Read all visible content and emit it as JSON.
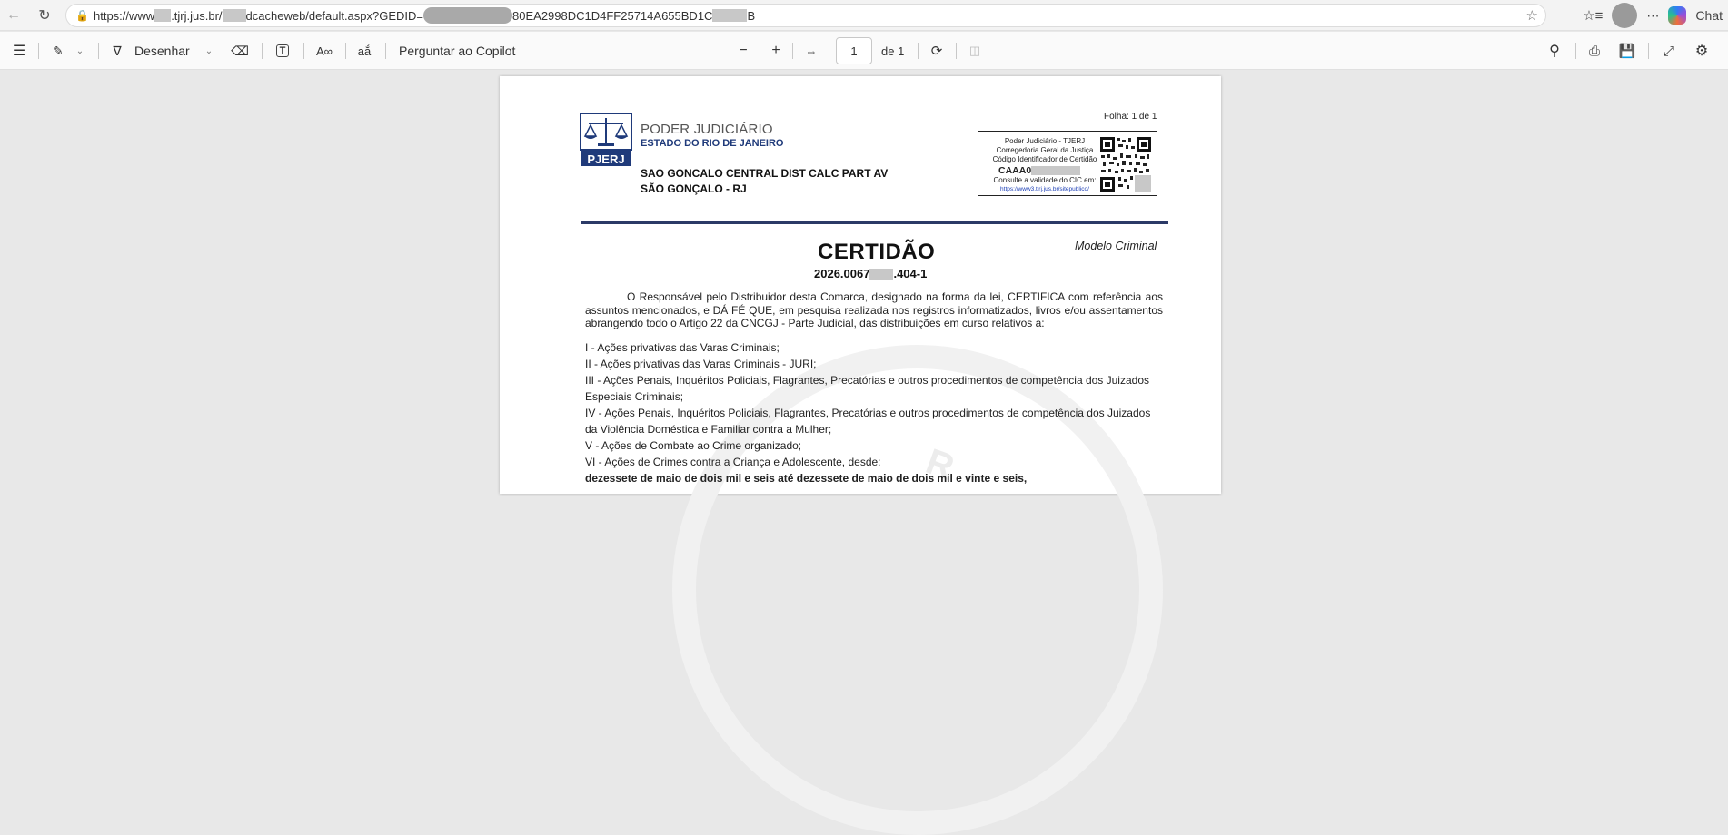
{
  "browser": {
    "url_prefix": "https://www",
    "url_mid1": ".tjrj.jus.br/",
    "url_mid2": "dcacheweb/default.aspx?GEDID=",
    "url_suffix": "80EA2998DC1D4FF25714A655BD1C",
    "url_end": "B",
    "chat_label": "Chat"
  },
  "toolbar": {
    "draw_label": "Desenhar",
    "copilot_label": "Perguntar ao Copilot",
    "page_current": "1",
    "page_total": "de 1"
  },
  "document": {
    "org_title": "PODER JUDICIÁRIO",
    "org_subtitle": "ESTADO DO RIO DE JANEIRO",
    "seal_text": "PJERJ",
    "district_line1": "SAO GONCALO CENTRAL DIST CALC PART AV",
    "district_line2": "SÃO GONÇALO - RJ",
    "folha": "Folha: 1 de 1",
    "cert_box": {
      "line1": "Poder Judiciário - TJERJ",
      "line2": "Corregedoria Geral da Justiça",
      "line3": "Código Identificador de Certidão",
      "code": "CAAA0",
      "line4": "Consulte a validade do CIC em:",
      "link": "https://www3.tjrj.jus.br/sitepublico/"
    },
    "title": "CERTIDÃO",
    "modelo": "Modelo Criminal",
    "number_prefix": "2026.0067",
    "number_suffix": ".404-1",
    "intro": "O Responsável pelo Distribuidor desta Comarca, designado na forma da lei, CERTIFICA com referência aos assuntos mencionados, e DÁ FÉ QUE, em pesquisa realizada nos registros informatizados, livros e/ou assentamentos abrangendo todo o Artigo 22 da CNCGJ - Parte Judicial, das distribuições em curso relativos a:",
    "items": [
      "I - Ações privativas das Varas Criminais;",
      "II - Ações privativas das Varas Criminais - JURI;",
      "III - Ações Penais, Inquéritos Policiais, Flagrantes, Precatórias e outros procedimentos de competência dos Juizados",
      "Especiais Criminais;",
      "IV - Ações Penais, Inquéritos Policiais, Flagrantes, Precatórias e outros procedimentos de competência dos Juizados",
      "da Violência Doméstica e Familiar contra a Mulher;",
      "V - Ações de Combate ao Crime organizado;",
      "VI - Ações de Crimes contra a Criança e Adolescente, desde:"
    ],
    "date_range": "dezessete de maio de dois mil e seis até dezessete de maio de dois mil e vinte e seis,"
  }
}
